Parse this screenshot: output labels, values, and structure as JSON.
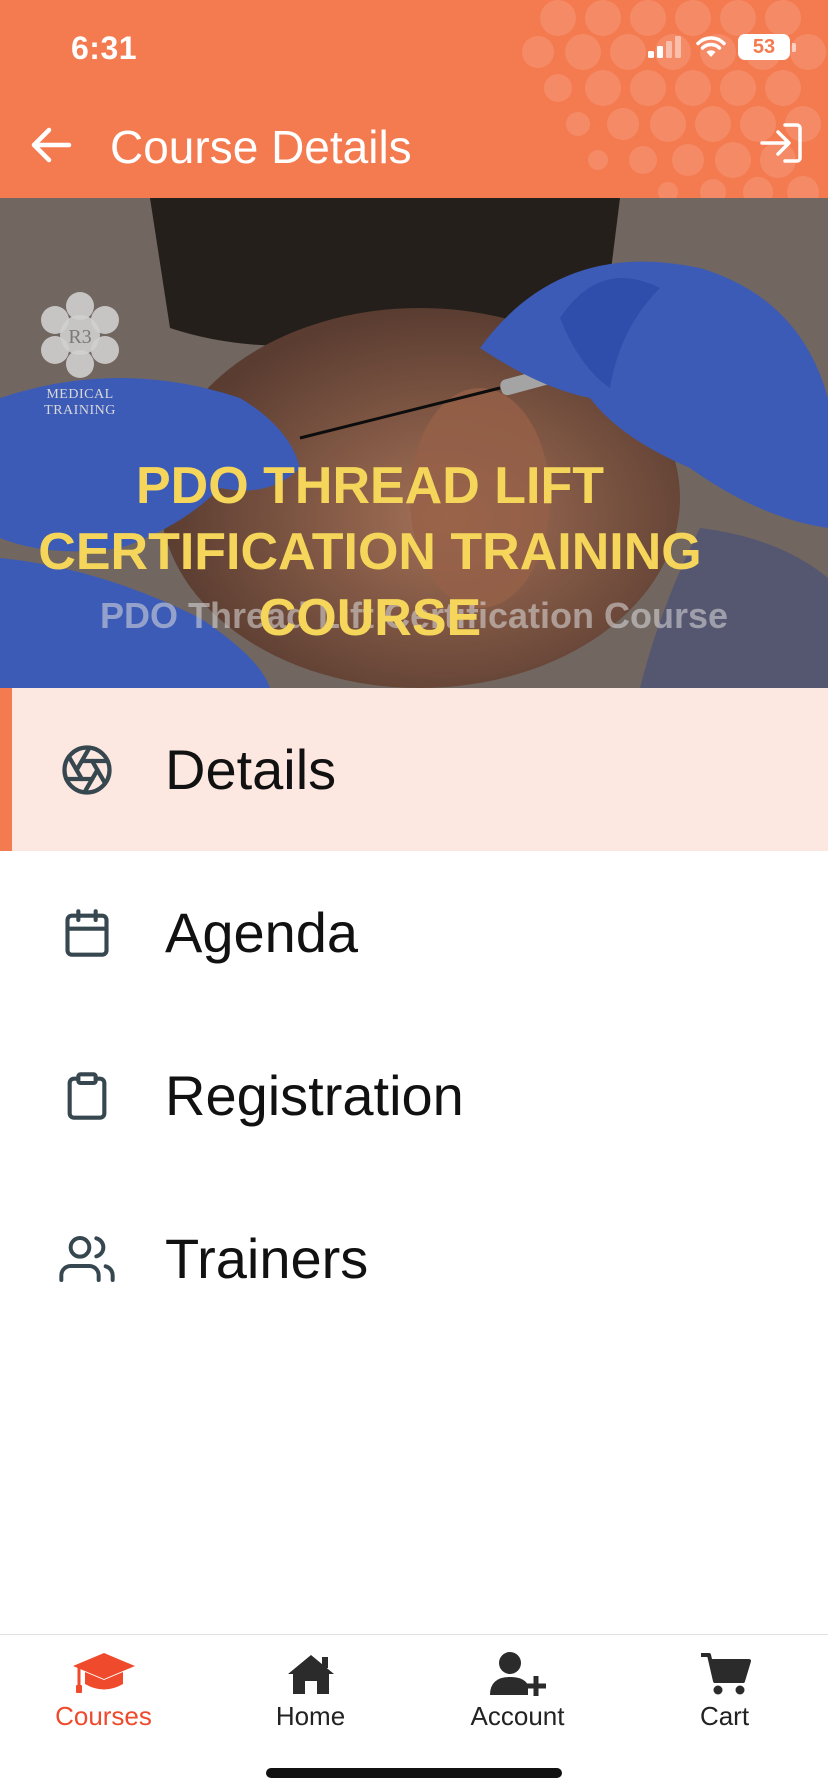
{
  "status_bar": {
    "time": "6:31",
    "battery": "53"
  },
  "header": {
    "title": "Course Details"
  },
  "banner": {
    "logo_mark": "R3",
    "logo_text": "MEDICAL TRAINING",
    "title": "PDO THREAD LIFT CERTIFICATION TRAINING COURSE",
    "subtitle": "PDO Thread Lift Certification Course"
  },
  "menu": {
    "items": [
      {
        "label": "Details",
        "icon": "aperture-icon",
        "active": true
      },
      {
        "label": "Agenda",
        "icon": "calendar-icon",
        "active": false
      },
      {
        "label": "Registration",
        "icon": "clipboard-icon",
        "active": false
      },
      {
        "label": "Trainers",
        "icon": "users-icon",
        "active": false
      }
    ]
  },
  "bottom_nav": {
    "items": [
      {
        "label": "Courses",
        "icon": "graduation-cap-icon",
        "active": true
      },
      {
        "label": "Home",
        "icon": "home-icon",
        "active": false
      },
      {
        "label": "Account",
        "icon": "user-plus-icon",
        "active": false
      },
      {
        "label": "Cart",
        "icon": "cart-icon",
        "active": false
      }
    ]
  },
  "colors": {
    "brand": "#f47a50",
    "active_bg": "#fde8e1",
    "active_nav": "#ef4a2c",
    "banner_title": "#f5d65a"
  }
}
